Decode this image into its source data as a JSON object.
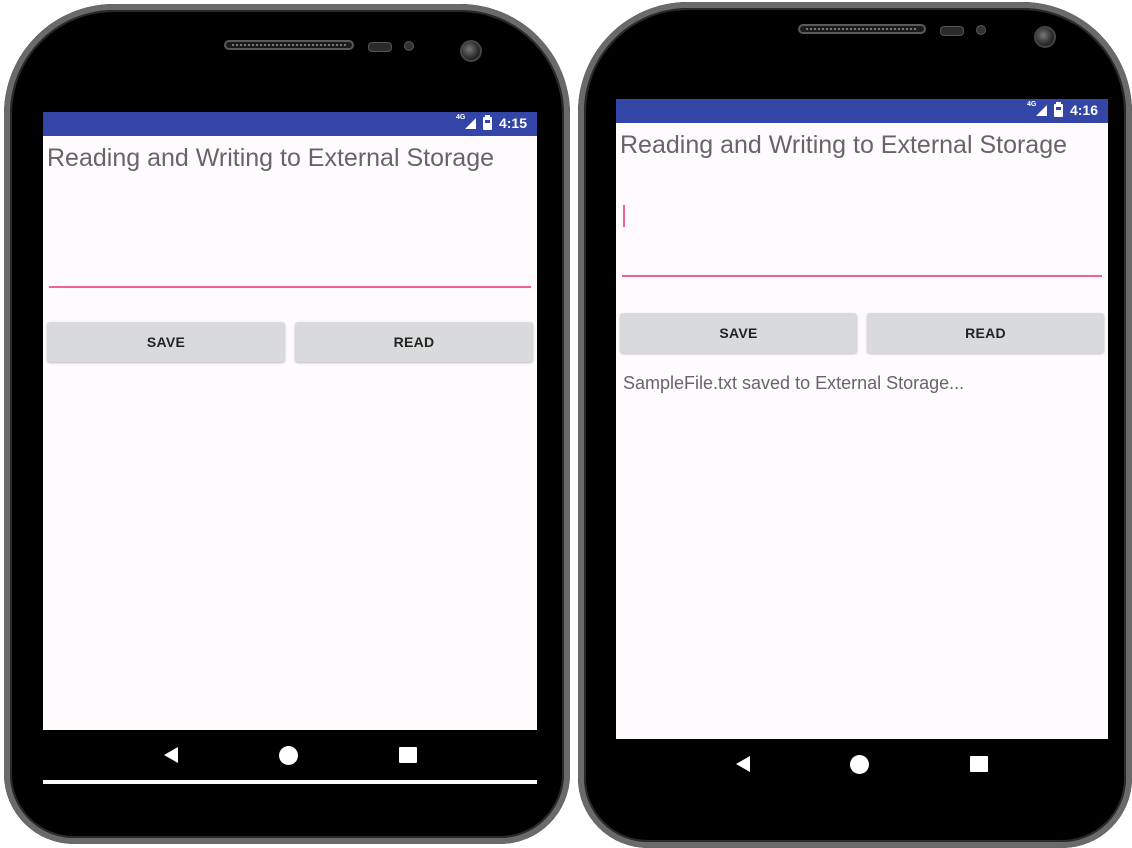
{
  "left_phone": {
    "status_time": "4:15",
    "network_label": "4G",
    "title": "Reading and Writing to External Storage",
    "input_value": "",
    "save_label": "SAVE",
    "read_label": "READ",
    "message": ""
  },
  "right_phone": {
    "status_time": "4:16",
    "network_label": "4G",
    "title": "Reading and Writing to External Storage",
    "input_value": "",
    "save_label": "SAVE",
    "read_label": "READ",
    "message": "SampleFile.txt saved to External Storage..."
  },
  "colors": {
    "status_bar": "#3346a8",
    "accent": "#f06292",
    "button_bg": "#d8dadb",
    "screen_bg": "#fefafd"
  },
  "icons": [
    "signal-icon",
    "battery-icon",
    "back-icon",
    "home-icon",
    "recents-icon"
  ]
}
